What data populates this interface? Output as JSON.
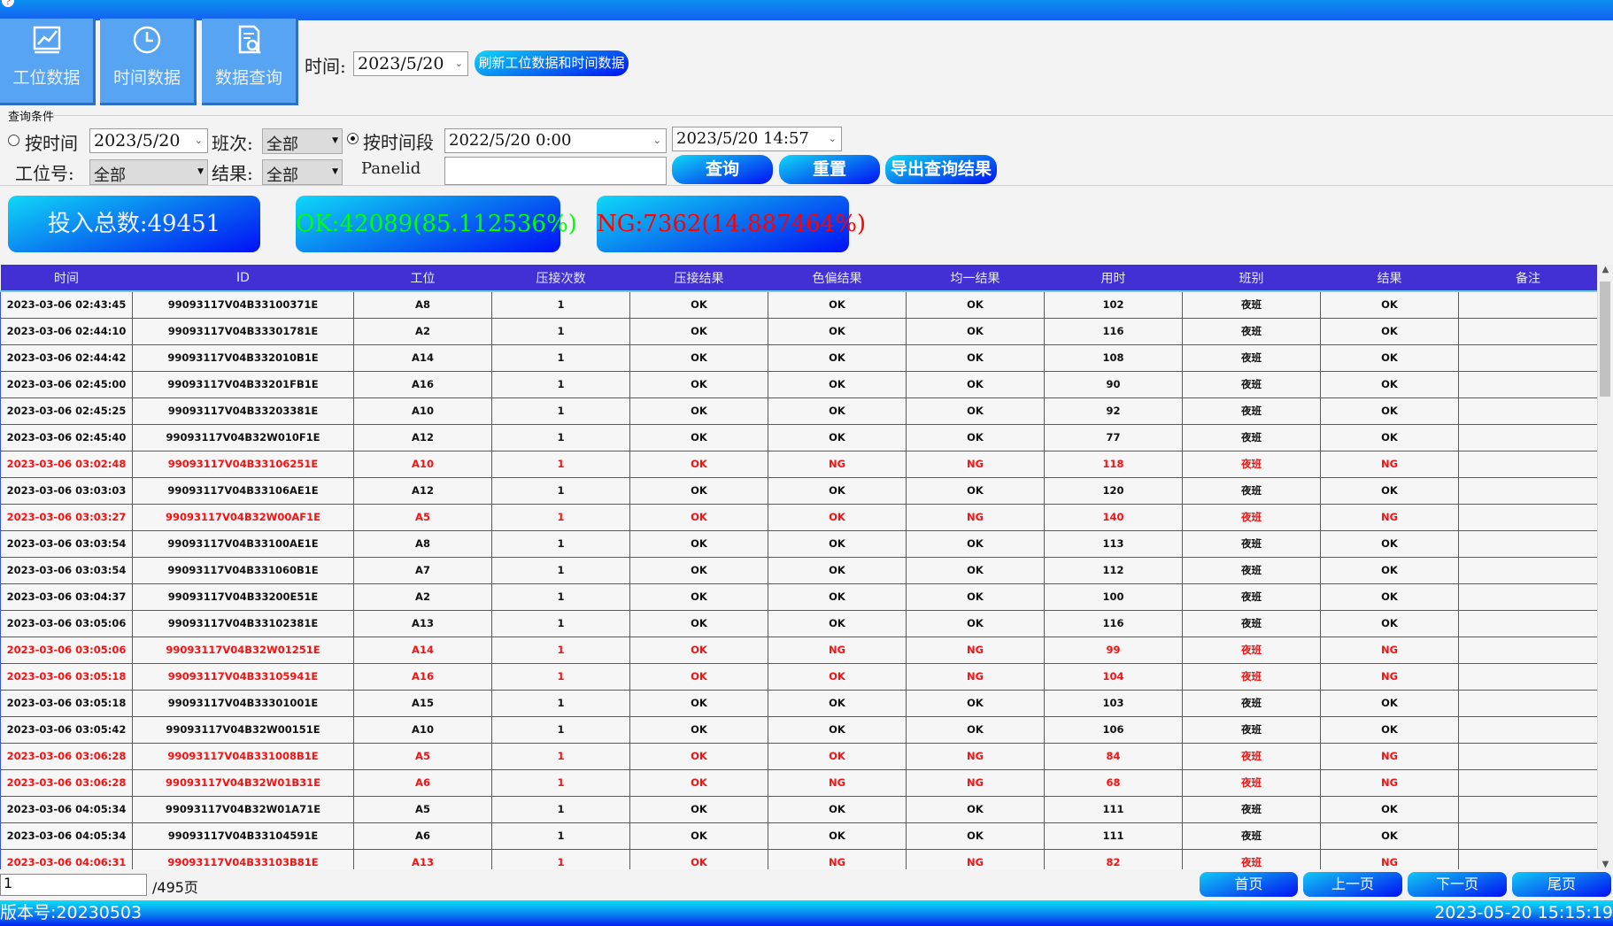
{
  "nav": [
    {
      "label": "工位数据",
      "icon": "chart-icon"
    },
    {
      "label": "时间数据",
      "icon": "clock-icon"
    },
    {
      "label": "数据查询",
      "icon": "document-search-icon"
    }
  ],
  "top": {
    "time_label": "时间:",
    "time_value": "2023/5/20",
    "refresh_label": "刷新工位数据和时间数据"
  },
  "query": {
    "group_label": "查询条件",
    "by_time_label": "按时间",
    "by_time_value": "2023/5/20",
    "shift_label": "班次:",
    "shift_value": "全部",
    "by_range_label": "按时间段",
    "range_start": "2022/5/20 0:00",
    "range_end": "2023/5/20 14:57",
    "station_label": "工位号:",
    "station_value": "全部",
    "result_label": "结果:",
    "result_value": "全部",
    "panelid_label": "Panelid",
    "panelid_value": "",
    "search_label": "查询",
    "reset_label": "重置",
    "export_label": "导出查询结果"
  },
  "stats": {
    "total": "投入总数:49451",
    "ok": "OK:42089(85.112536%)",
    "ng": "NG:7362(14.887464%)"
  },
  "colors": {
    "ok": "#00ff00",
    "ng": "#ff0000",
    "header": "#4230d4"
  },
  "table": {
    "headers": [
      "时间",
      "ID",
      "工位",
      "压接次数",
      "压接结果",
      "色偏结果",
      "均一结果",
      "用时",
      "班别",
      "结果",
      "备注"
    ],
    "rows": [
      [
        "2023-03-06 02:43:45",
        "99093117V04B33100371E",
        "A8",
        "1",
        "OK",
        "OK",
        "OK",
        "102",
        "夜班",
        "OK",
        ""
      ],
      [
        "2023-03-06 02:44:10",
        "99093117V04B33301781E",
        "A2",
        "1",
        "OK",
        "OK",
        "OK",
        "116",
        "夜班",
        "OK",
        ""
      ],
      [
        "2023-03-06 02:44:42",
        "99093117V04B332010B1E",
        "A14",
        "1",
        "OK",
        "OK",
        "OK",
        "108",
        "夜班",
        "OK",
        ""
      ],
      [
        "2023-03-06 02:45:00",
        "99093117V04B33201FB1E",
        "A16",
        "1",
        "OK",
        "OK",
        "OK",
        "90",
        "夜班",
        "OK",
        ""
      ],
      [
        "2023-03-06 02:45:25",
        "99093117V04B33203381E",
        "A10",
        "1",
        "OK",
        "OK",
        "OK",
        "92",
        "夜班",
        "OK",
        ""
      ],
      [
        "2023-03-06 02:45:40",
        "99093117V04B32W010F1E",
        "A12",
        "1",
        "OK",
        "OK",
        "OK",
        "77",
        "夜班",
        "OK",
        ""
      ],
      [
        "2023-03-06 03:02:48",
        "99093117V04B33106251E",
        "A10",
        "1",
        "OK",
        "NG",
        "NG",
        "118",
        "夜班",
        "NG",
        ""
      ],
      [
        "2023-03-06 03:03:03",
        "99093117V04B33106AE1E",
        "A12",
        "1",
        "OK",
        "OK",
        "OK",
        "120",
        "夜班",
        "OK",
        ""
      ],
      [
        "2023-03-06 03:03:27",
        "99093117V04B32W00AF1E",
        "A5",
        "1",
        "OK",
        "OK",
        "NG",
        "140",
        "夜班",
        "NG",
        ""
      ],
      [
        "2023-03-06 03:03:54",
        "99093117V04B33100AE1E",
        "A8",
        "1",
        "OK",
        "OK",
        "OK",
        "113",
        "夜班",
        "OK",
        ""
      ],
      [
        "2023-03-06 03:03:54",
        "99093117V04B331060B1E",
        "A7",
        "1",
        "OK",
        "OK",
        "OK",
        "112",
        "夜班",
        "OK",
        ""
      ],
      [
        "2023-03-06 03:04:37",
        "99093117V04B33200E51E",
        "A2",
        "1",
        "OK",
        "OK",
        "OK",
        "100",
        "夜班",
        "OK",
        ""
      ],
      [
        "2023-03-06 03:05:06",
        "99093117V04B33102381E",
        "A13",
        "1",
        "OK",
        "OK",
        "OK",
        "116",
        "夜班",
        "OK",
        ""
      ],
      [
        "2023-03-06 03:05:06",
        "99093117V04B32W01251E",
        "A14",
        "1",
        "OK",
        "NG",
        "NG",
        "99",
        "夜班",
        "NG",
        ""
      ],
      [
        "2023-03-06 03:05:18",
        "99093117V04B33105941E",
        "A16",
        "1",
        "OK",
        "OK",
        "NG",
        "104",
        "夜班",
        "NG",
        ""
      ],
      [
        "2023-03-06 03:05:18",
        "99093117V04B33301001E",
        "A15",
        "1",
        "OK",
        "OK",
        "OK",
        "103",
        "夜班",
        "OK",
        ""
      ],
      [
        "2023-03-06 03:05:42",
        "99093117V04B32W00151E",
        "A10",
        "1",
        "OK",
        "OK",
        "OK",
        "106",
        "夜班",
        "OK",
        ""
      ],
      [
        "2023-03-06 03:06:28",
        "99093117V04B331008B1E",
        "A5",
        "1",
        "OK",
        "OK",
        "NG",
        "84",
        "夜班",
        "NG",
        ""
      ],
      [
        "2023-03-06 03:06:28",
        "99093117V04B32W01B31E",
        "A6",
        "1",
        "OK",
        "NG",
        "NG",
        "68",
        "夜班",
        "NG",
        ""
      ],
      [
        "2023-03-06 04:05:34",
        "99093117V04B32W01A71E",
        "A5",
        "1",
        "OK",
        "OK",
        "OK",
        "111",
        "夜班",
        "OK",
        ""
      ],
      [
        "2023-03-06 04:05:34",
        "99093117V04B33104591E",
        "A6",
        "1",
        "OK",
        "OK",
        "OK",
        "111",
        "夜班",
        "OK",
        ""
      ],
      [
        "2023-03-06 04:06:31",
        "99093117V04B33103B81E",
        "A13",
        "1",
        "OK",
        "NG",
        "NG",
        "82",
        "夜班",
        "NG",
        ""
      ]
    ]
  },
  "pager": {
    "page_value": "1",
    "total_label": "/495页",
    "first": "首页",
    "prev": "上一页",
    "next": "下一页",
    "last": "尾页"
  },
  "status": {
    "version": "版本号:20230503",
    "datetime": "2023-05-20 15:15:19"
  }
}
